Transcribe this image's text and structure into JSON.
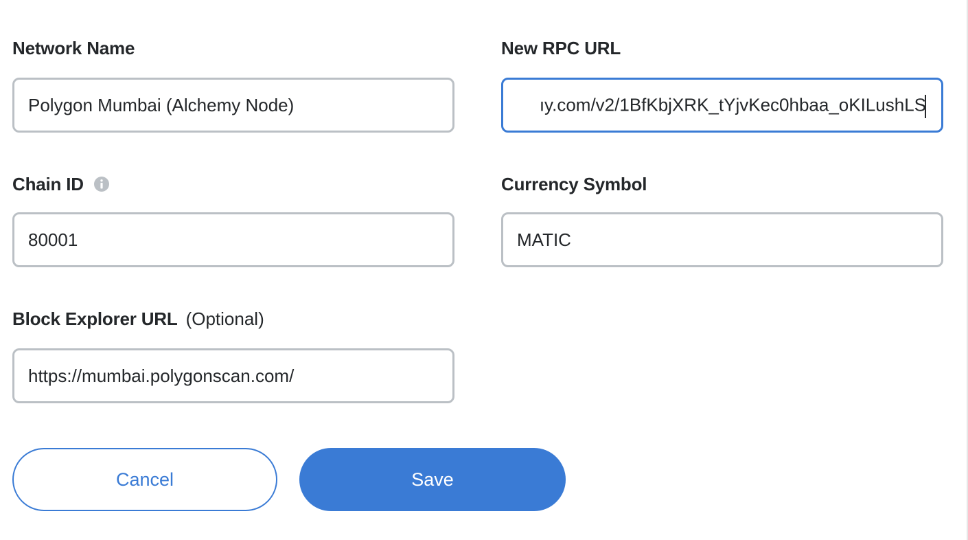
{
  "network_name": {
    "label": "Network Name",
    "value": "Polygon Mumbai (Alchemy Node)"
  },
  "rpc_url": {
    "label": "New RPC URL",
    "value": "ıy.com/v2/1BfKbjXRK_tYjvKec0hbaa_oKILushLS"
  },
  "chain_id": {
    "label": "Chain ID",
    "value": "80001",
    "info_icon": "info-icon"
  },
  "currency_symbol": {
    "label": "Currency Symbol",
    "value": "MATIC"
  },
  "block_explorer": {
    "label": "Block Explorer URL",
    "optional_label": "(Optional)",
    "value": "https://mumbai.polygonscan.com/"
  },
  "actions": {
    "cancel_label": "Cancel",
    "save_label": "Save"
  },
  "colors": {
    "accent": "#3a7bd5",
    "input_border": "#bbc0c5",
    "text": "#24272a",
    "info_icon": "#bbc0c5"
  }
}
